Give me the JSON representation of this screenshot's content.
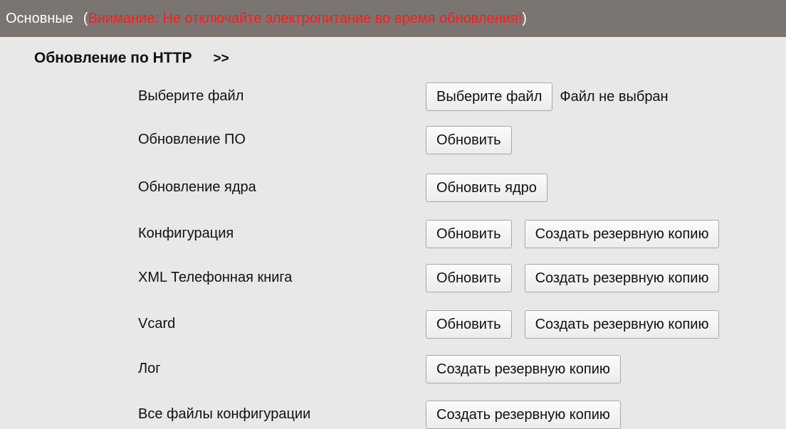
{
  "header": {
    "title": "Основные",
    "open_paren": "(",
    "warning": "Внимание: Не отключайте электропитание во время обновления!",
    "close_paren": ")"
  },
  "section": {
    "title": "Обновление по HTTP",
    "arrows": ">>"
  },
  "rows": [
    {
      "label": "Выберите файл",
      "buttons": [
        "Выберите файл"
      ],
      "status": "Файл не выбран"
    },
    {
      "label": "Обновление ПО",
      "buttons": [
        "Обновить"
      ]
    },
    {
      "label": "Обновление ядра",
      "buttons": [
        "Обновить ядро"
      ]
    },
    {
      "label": "Конфигурация",
      "buttons": [
        "Обновить",
        "Создать резервную копию"
      ]
    },
    {
      "label": "XML Телефонная книга",
      "buttons": [
        "Обновить",
        "Создать резервную копию"
      ]
    },
    {
      "label": "Vcard",
      "buttons": [
        "Обновить",
        "Создать резервную копию"
      ]
    },
    {
      "label": "Лог",
      "buttons": [
        "Создать резервную копию"
      ]
    },
    {
      "label": "Все файлы конфигурации",
      "buttons": [
        "Создать резервную копию"
      ]
    }
  ],
  "colors": {
    "header_bg": "#7a7571",
    "warning_text": "#ff1a1a",
    "page_bg": "#e8e8e8"
  }
}
